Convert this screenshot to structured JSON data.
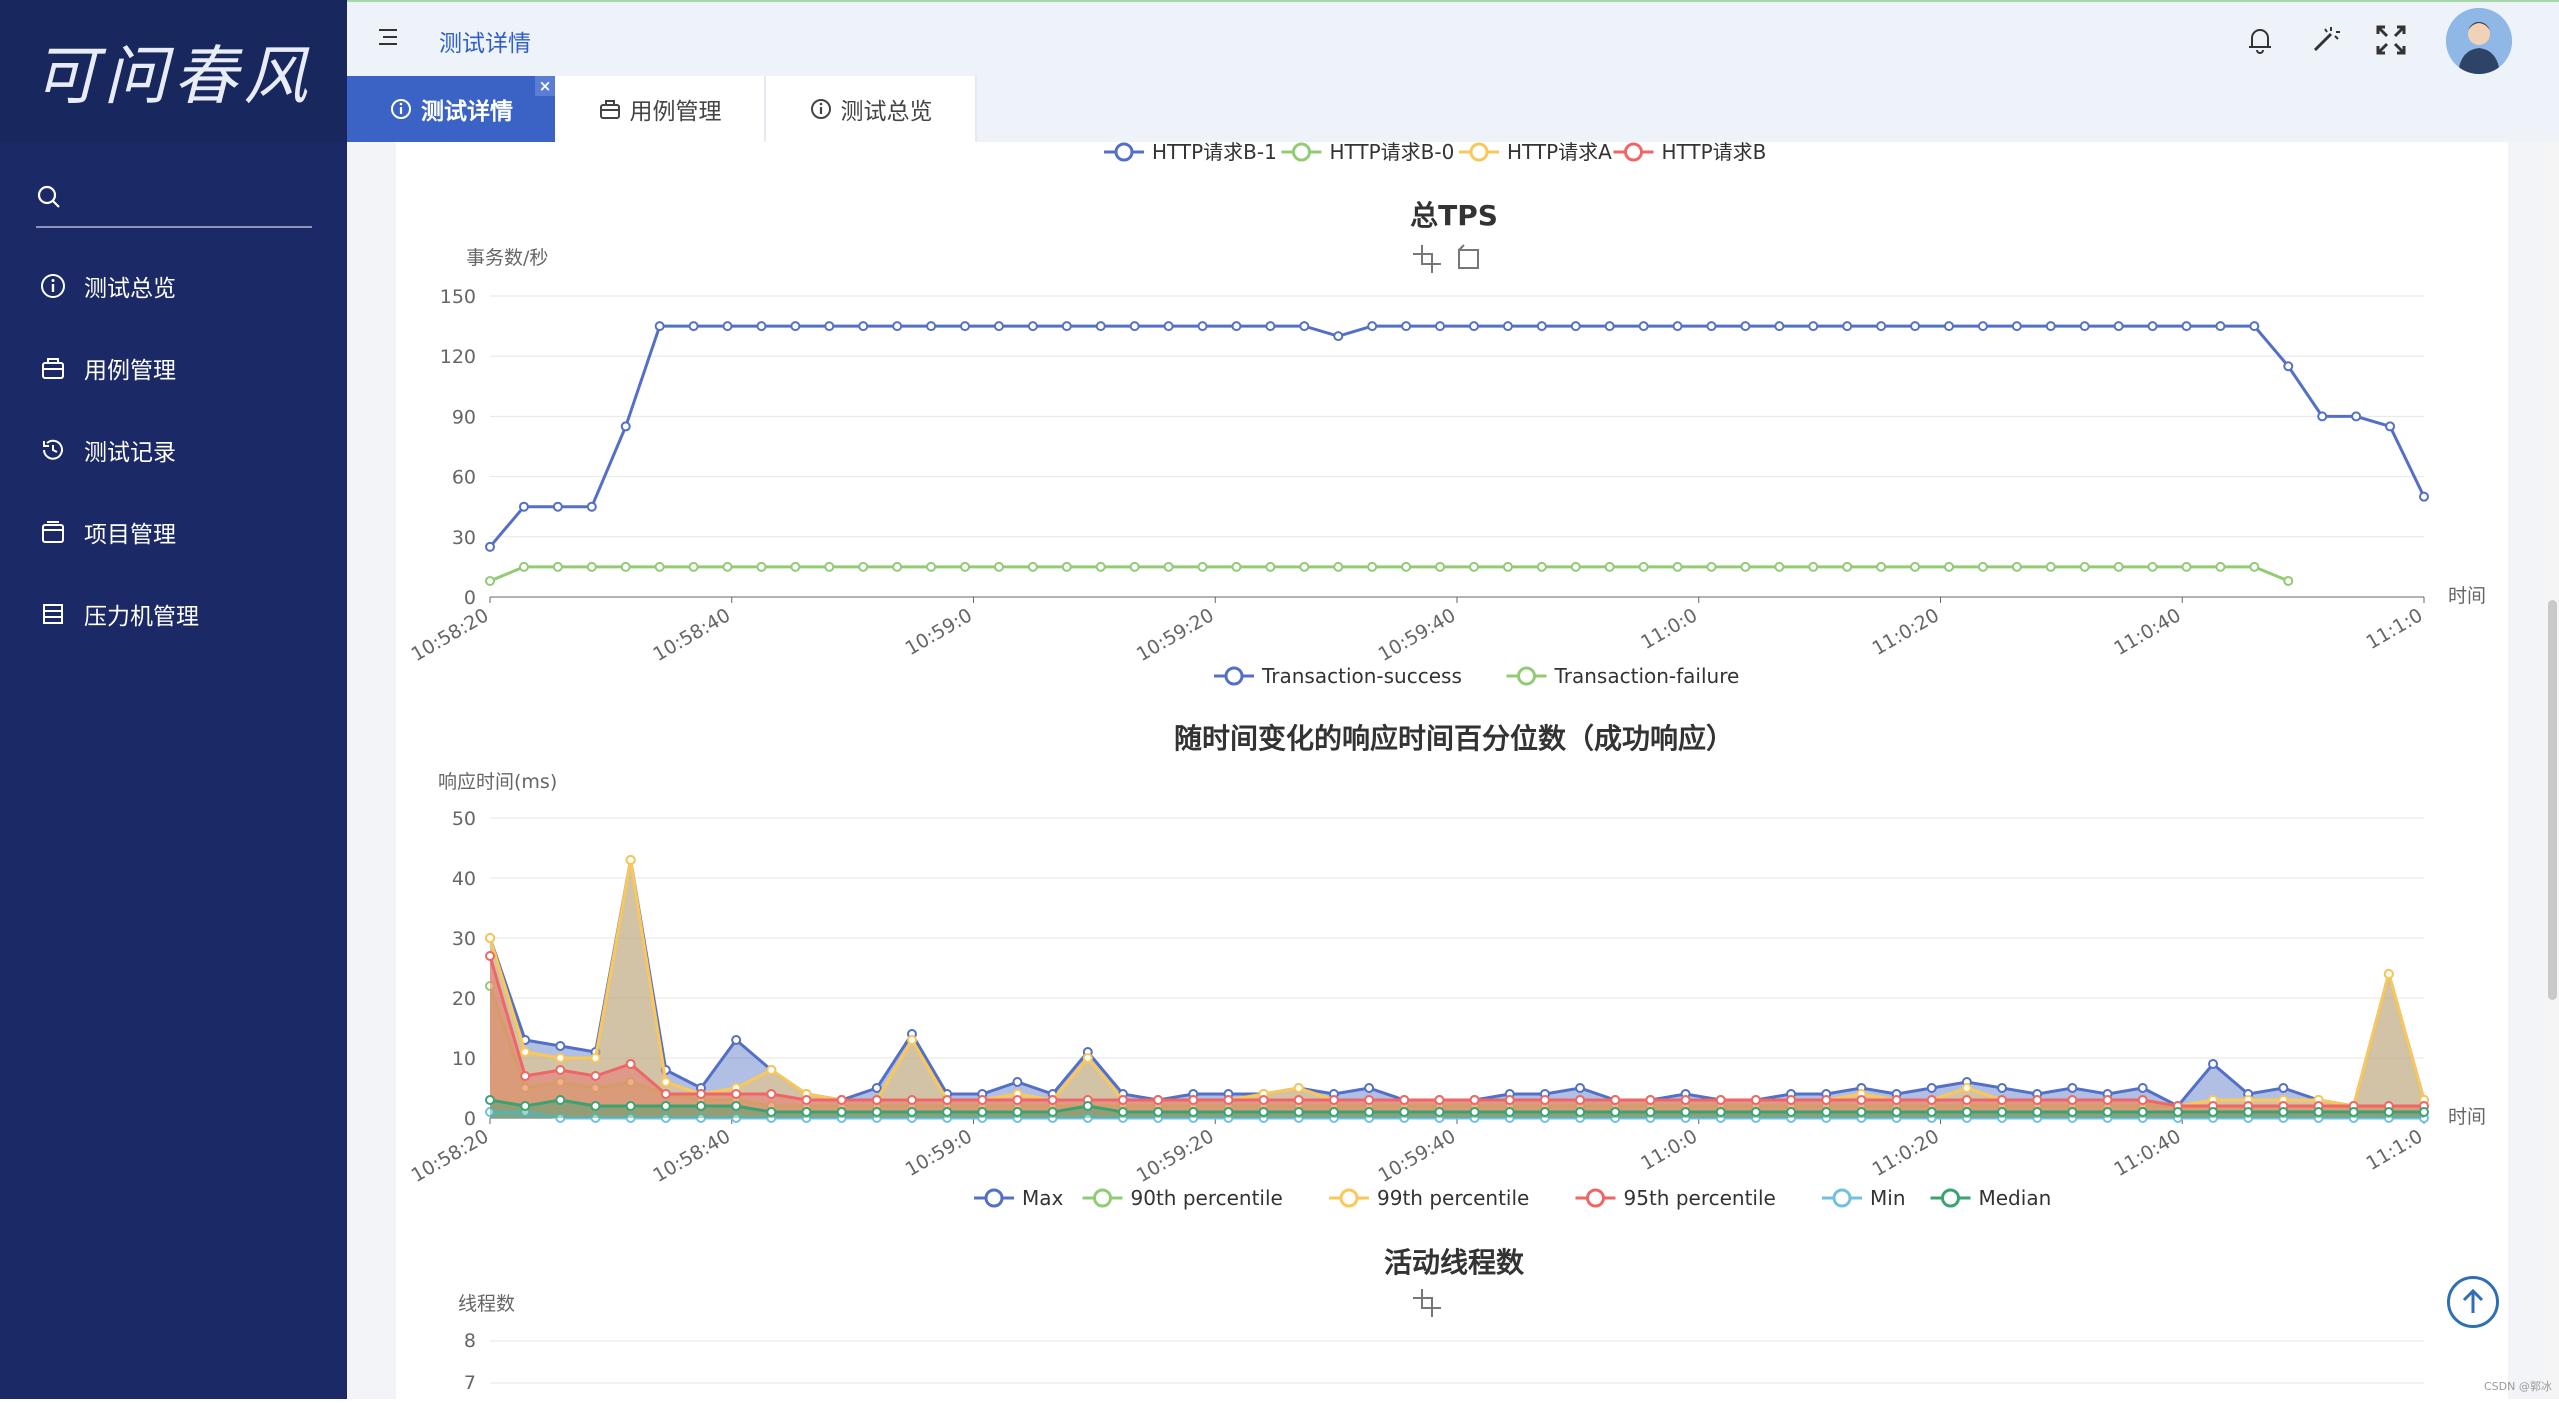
{
  "app": {
    "logo_text": "可问春风"
  },
  "search": {
    "placeholder": ""
  },
  "sidebar": {
    "items": [
      {
        "label": "测试总览",
        "icon": "info-icon"
      },
      {
        "label": "用例管理",
        "icon": "case-bag-icon"
      },
      {
        "label": "测试记录",
        "icon": "history-icon"
      },
      {
        "label": "项目管理",
        "icon": "project-icon"
      },
      {
        "label": "压力机管理",
        "icon": "server-icon"
      }
    ]
  },
  "header": {
    "breadcrumb": "测试详情",
    "icons": [
      "bell-icon",
      "magic-wand-icon",
      "fullscreen-icon",
      "avatar"
    ]
  },
  "tabs": [
    {
      "label": "测试详情",
      "active": true,
      "icon": "info-icon"
    },
    {
      "label": "用例管理",
      "active": false,
      "icon": "case-bag-icon"
    },
    {
      "label": "测试总览",
      "active": false,
      "icon": "info-icon"
    }
  ],
  "tab_close_glyph": "×",
  "top_legend": {
    "items": [
      {
        "name": "HTTP请求B-1",
        "color": "#5470c6"
      },
      {
        "name": "HTTP请求B-0",
        "color": "#91cc75"
      },
      {
        "name": "HTTP请求A",
        "color": "#fac858"
      },
      {
        "name": "HTTP请求B",
        "color": "#ee6666"
      }
    ]
  },
  "chart_data": [
    {
      "type": "line",
      "title": "总TPS",
      "ylabel": "事务数/秒",
      "xlabel": "时间",
      "ylim": [
        0,
        150
      ],
      "yticks": [
        "0",
        "30",
        "60",
        "90",
        "120",
        "150"
      ],
      "xticks": [
        "10:58:20",
        "10:58:40",
        "10:59:0",
        "10:59:20",
        "10:59:40",
        "11:0:0",
        "11:0:20",
        "11:0:40",
        "11:1:0"
      ],
      "grid": true,
      "legend_position": "bottom",
      "series": [
        {
          "name": "Transaction-success",
          "color": "#5470c6",
          "values": [
            25,
            45,
            45,
            45,
            85,
            135,
            135,
            135,
            135,
            135,
            135,
            135,
            135,
            135,
            135,
            135,
            135,
            135,
            135,
            135,
            135,
            135,
            135,
            135,
            135,
            130,
            135,
            135,
            135,
            135,
            135,
            135,
            135,
            135,
            135,
            135,
            135,
            135,
            135,
            135,
            135,
            135,
            135,
            135,
            135,
            135,
            135,
            135,
            135,
            135,
            135,
            135,
            135,
            115,
            90,
            90,
            85,
            50
          ]
        },
        {
          "name": "Transaction-failure",
          "color": "#91cc75",
          "values": [
            8,
            15,
            15,
            15,
            15,
            15,
            15,
            15,
            15,
            15,
            15,
            15,
            15,
            15,
            15,
            15,
            15,
            15,
            15,
            15,
            15,
            15,
            15,
            15,
            15,
            15,
            15,
            15,
            15,
            15,
            15,
            15,
            15,
            15,
            15,
            15,
            15,
            15,
            15,
            15,
            15,
            15,
            15,
            15,
            15,
            15,
            15,
            15,
            15,
            15,
            15,
            15,
            15,
            8
          ]
        }
      ],
      "toolbox": [
        "zoom-icon",
        "restore-icon"
      ]
    },
    {
      "type": "area",
      "title": "随时间变化的响应时间百分位数（成功响应）",
      "ylabel": "响应时间(ms)",
      "xlabel": "时间",
      "ylim": [
        0,
        50
      ],
      "yticks": [
        "0",
        "10",
        "20",
        "30",
        "40",
        "50"
      ],
      "xticks": [
        "10:58:20",
        "10:58:40",
        "10:59:0",
        "10:59:20",
        "10:59:40",
        "11:0:0",
        "11:0:20",
        "11:0:40",
        "11:1:0"
      ],
      "grid": true,
      "legend_position": "bottom",
      "series": [
        {
          "name": "Max",
          "color": "#5470c6",
          "values": [
            30,
            13,
            12,
            11,
            43,
            8,
            5,
            13,
            8,
            4,
            3,
            5,
            14,
            4,
            4,
            6,
            4,
            11,
            4,
            3,
            4,
            4,
            4,
            5,
            4,
            5,
            3,
            3,
            3,
            4,
            4,
            5,
            3,
            3,
            4,
            3,
            3,
            4,
            4,
            5,
            4,
            5,
            6,
            5,
            4,
            5,
            4,
            5,
            2,
            9,
            4,
            5,
            3,
            2,
            24,
            3
          ]
        },
        {
          "name": "90th percentile",
          "color": "#91cc75",
          "values": [
            22,
            5,
            6,
            5,
            6,
            4,
            3,
            3,
            2,
            2,
            2,
            2,
            2,
            2,
            2,
            2,
            2,
            2,
            2,
            2,
            2,
            2,
            2,
            2,
            2,
            2,
            2,
            2,
            2,
            2,
            2,
            2,
            2,
            2,
            2,
            2,
            2,
            2,
            2,
            2,
            2,
            2,
            2,
            2,
            2,
            2,
            2,
            2,
            2,
            2,
            2,
            2,
            2,
            2,
            2,
            2
          ]
        },
        {
          "name": "99th percentile",
          "color": "#fac858",
          "values": [
            30,
            11,
            10,
            10,
            43,
            6,
            4,
            5,
            8,
            4,
            3,
            3,
            13,
            3,
            3,
            4,
            3,
            10,
            3,
            3,
            3,
            3,
            4,
            5,
            3,
            3,
            3,
            3,
            3,
            3,
            3,
            3,
            3,
            3,
            3,
            3,
            3,
            3,
            3,
            4,
            3,
            3,
            5,
            3,
            3,
            3,
            3,
            3,
            2,
            3,
            3,
            3,
            3,
            2,
            24,
            3
          ]
        },
        {
          "name": "95th percentile",
          "color": "#ee6666",
          "values": [
            27,
            7,
            8,
            7,
            9,
            4,
            4,
            4,
            4,
            3,
            3,
            3,
            3,
            3,
            3,
            3,
            3,
            3,
            3,
            3,
            3,
            3,
            3,
            3,
            3,
            3,
            3,
            3,
            3,
            3,
            3,
            3,
            3,
            3,
            3,
            3,
            3,
            3,
            3,
            3,
            3,
            3,
            3,
            3,
            3,
            3,
            3,
            3,
            2,
            2,
            2,
            2,
            2,
            2,
            2,
            2
          ]
        },
        {
          "name": "Min",
          "color": "#73c0de",
          "values": [
            1,
            1,
            0,
            0,
            0,
            0,
            0,
            0,
            0,
            0,
            0,
            0,
            0,
            0,
            0,
            0,
            0,
            0,
            0,
            0,
            0,
            0,
            0,
            0,
            0,
            0,
            0,
            0,
            0,
            0,
            0,
            0,
            0,
            0,
            0,
            0,
            0,
            0,
            0,
            0,
            0,
            0,
            0,
            0,
            0,
            0,
            0,
            0,
            0,
            0,
            0,
            0,
            0,
            0,
            0,
            0
          ]
        },
        {
          "name": "Median",
          "color": "#3ba272",
          "values": [
            3,
            2,
            3,
            2,
            2,
            2,
            2,
            2,
            1,
            1,
            1,
            1,
            1,
            1,
            1,
            1,
            1,
            2,
            1,
            1,
            1,
            1,
            1,
            1,
            1,
            1,
            1,
            1,
            1,
            1,
            1,
            1,
            1,
            1,
            1,
            1,
            1,
            1,
            1,
            1,
            1,
            1,
            1,
            1,
            1,
            1,
            1,
            1,
            1,
            1,
            1,
            1,
            1,
            1,
            1,
            1
          ]
        }
      ],
      "toolbox": [
        "zoom-icon",
        "restore-icon"
      ]
    },
    {
      "type": "line",
      "title": "活动线程数",
      "ylabel": "线程数",
      "yticks_visible": [
        "8",
        "7"
      ],
      "grid": true,
      "series": [],
      "toolbox": [
        "zoom-icon"
      ]
    }
  ],
  "back_to_top": "back-to-top-icon",
  "watermark": "CSDN @郭冰"
}
